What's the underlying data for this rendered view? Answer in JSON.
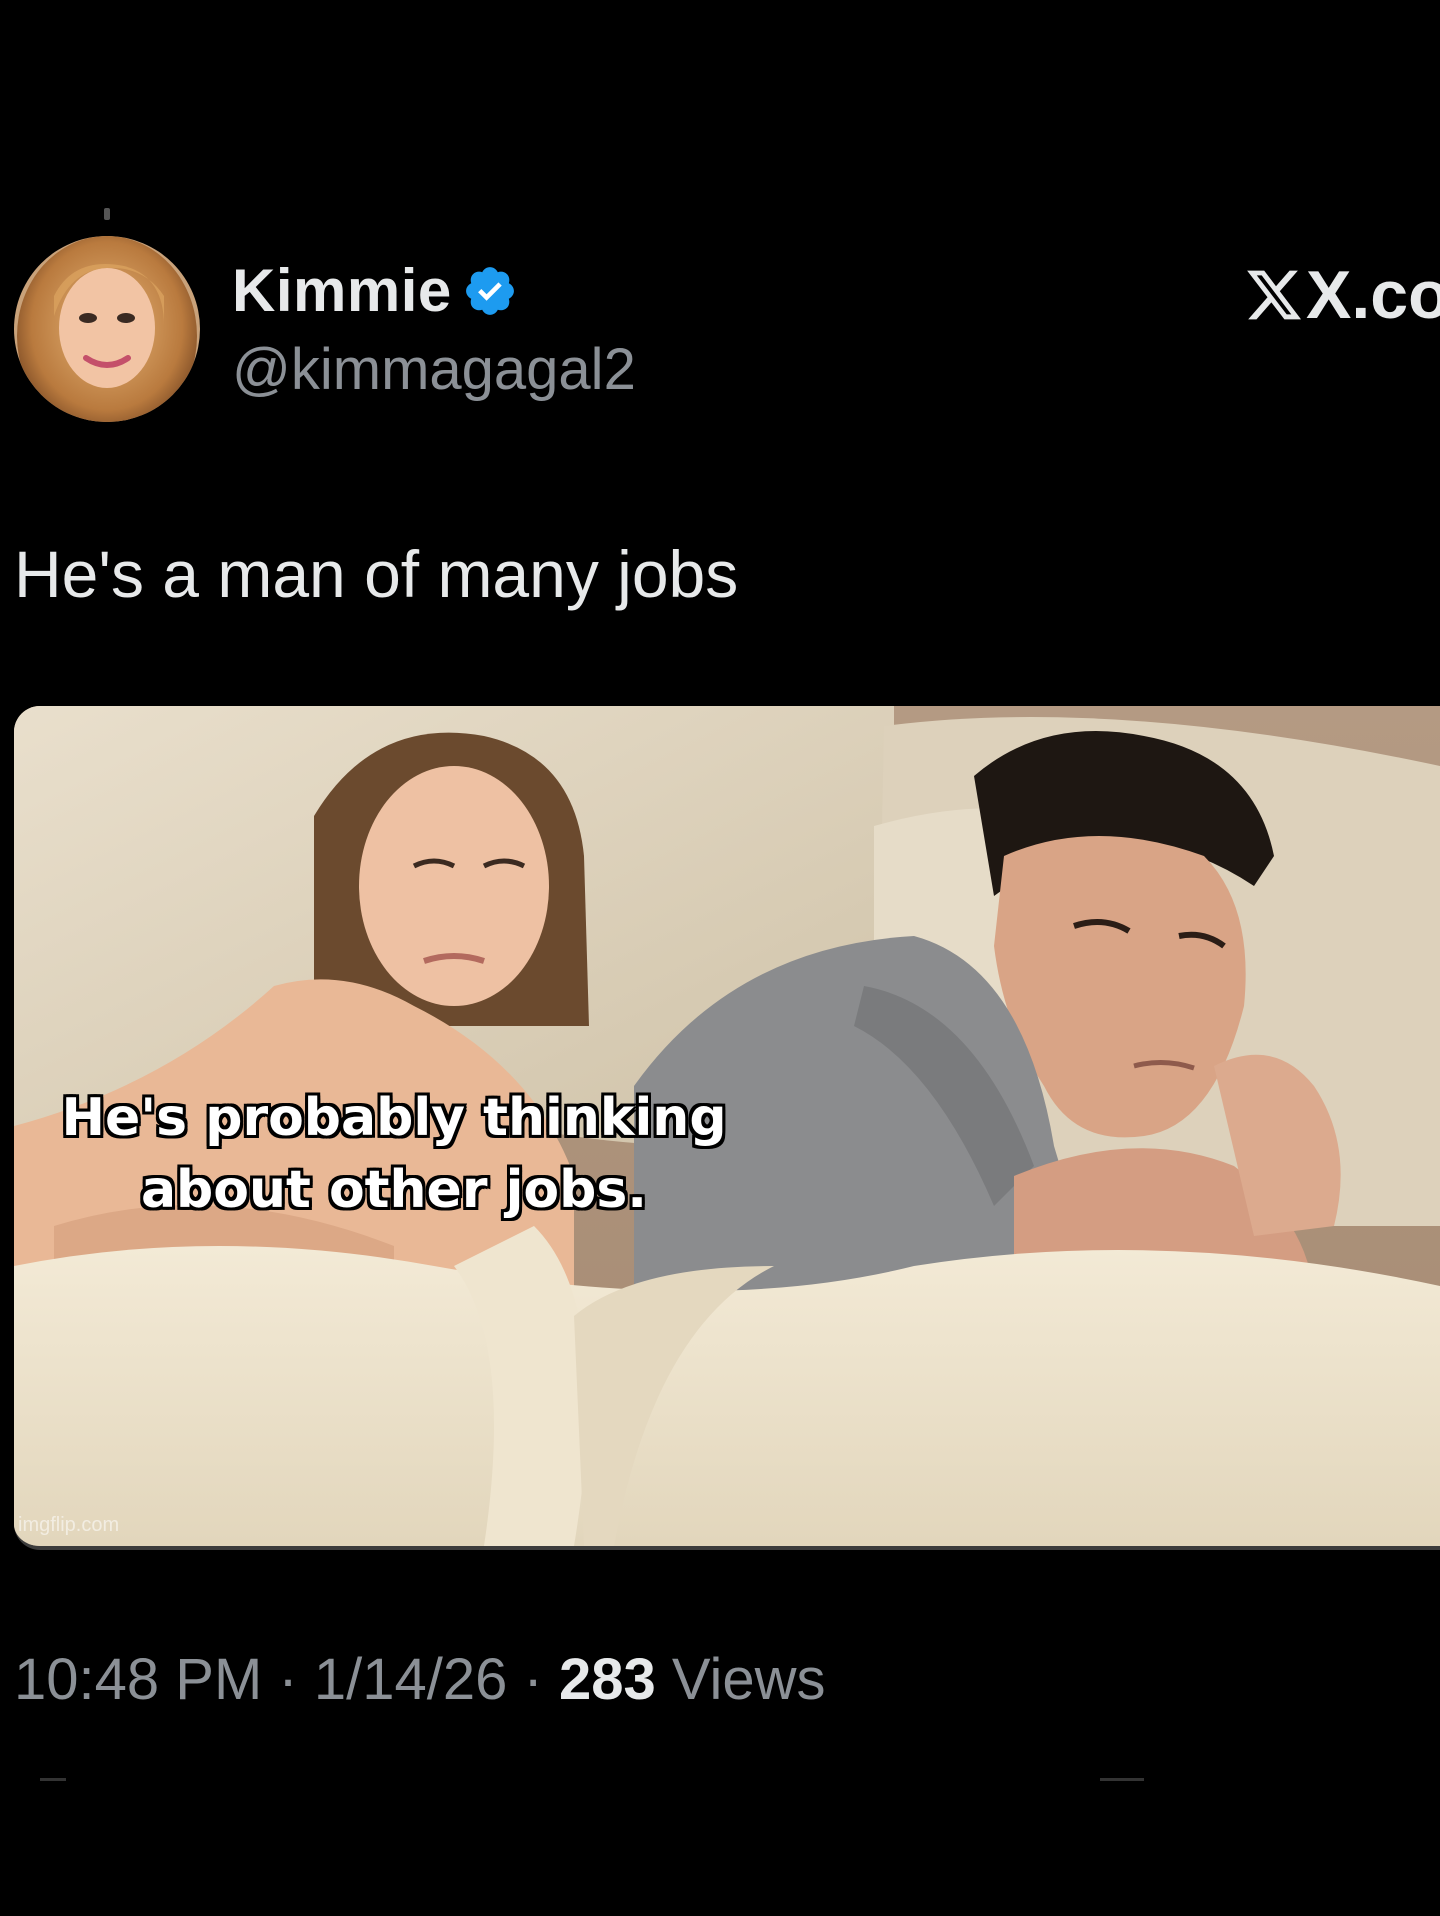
{
  "tweet": {
    "author": {
      "display_name": "Kimmie",
      "handle": "@kimmagagal2",
      "verified": true,
      "avatar_icon": "profile-photo"
    },
    "source": "X.com",
    "text": "He's a man of many jobs",
    "media": {
      "caption_line1": "He's probably thinking",
      "caption_line2": "about other jobs.",
      "watermark": "imgflip.com"
    },
    "meta": {
      "time": "10:48 PM",
      "separator": "·",
      "date": "1/14/26",
      "views_count": "283",
      "views_label": "Views"
    }
  },
  "colors": {
    "background": "#000000",
    "primary_text": "#e7e9ea",
    "secondary_text": "#8b9096",
    "verified_blue": "#1d9bf0"
  }
}
